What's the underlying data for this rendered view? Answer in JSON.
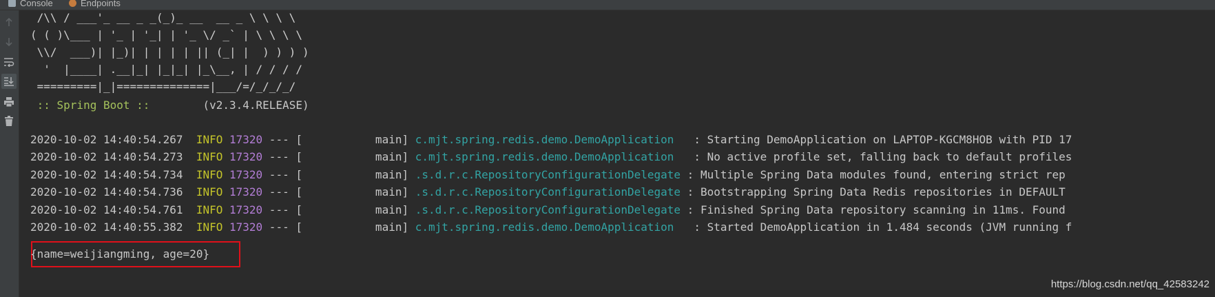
{
  "tabs": [
    {
      "label": "Console",
      "icon": "console-icon"
    },
    {
      "label": "Endpoints",
      "icon": "endpoints-icon"
    }
  ],
  "toolbar": {
    "buttons": [
      {
        "icon": "arrow-up-icon"
      },
      {
        "icon": "arrow-down-icon"
      },
      {
        "icon": "soft-wrap-icon"
      },
      {
        "icon": "scroll-to-end-icon",
        "active": true
      },
      {
        "icon": "print-icon"
      },
      {
        "icon": "clear-all-icon"
      }
    ]
  },
  "banner": {
    "lines": [
      " /\\\\ / ___'_ __ _ _(_)_ __  __ _ \\ \\ \\ \\",
      "( ( )\\___ | '_ | '_| | '_ \\/ _` | \\ \\ \\ \\",
      " \\\\/  ___)| |_)| | | | | || (_| |  ) ) ) )",
      "  '  |____| .__|_| |_|_| |_\\__, | / / / /",
      " =========|_|==============|___/=/_/_/_/"
    ],
    "boot_label": " :: Spring Boot :: ",
    "boot_version": "       (v2.3.4.RELEASE)"
  },
  "logs": [
    {
      "timestamp": "2020-10-02 14:40:54.267",
      "level": "INFO",
      "pid": "17320",
      "sep": " --- [",
      "thread": "           main]",
      "logger": "c.mjt.spring.redis.demo.DemoApplication  ",
      "message": ": Starting DemoApplication on LAPTOP-KGCM8HOB with PID 17"
    },
    {
      "timestamp": "2020-10-02 14:40:54.273",
      "level": "INFO",
      "pid": "17320",
      "sep": " --- [",
      "thread": "           main]",
      "logger": "c.mjt.spring.redis.demo.DemoApplication  ",
      "message": ": No active profile set, falling back to default profiles"
    },
    {
      "timestamp": "2020-10-02 14:40:54.734",
      "level": "INFO",
      "pid": "17320",
      "sep": " --- [",
      "thread": "           main]",
      "logger": ".s.d.r.c.RepositoryConfigurationDelegate",
      "message": " : Multiple Spring Data modules found, entering strict rep"
    },
    {
      "timestamp": "2020-10-02 14:40:54.736",
      "level": "INFO",
      "pid": "17320",
      "sep": " --- [",
      "thread": "           main]",
      "logger": ".s.d.r.c.RepositoryConfigurationDelegate",
      "message": " : Bootstrapping Spring Data Redis repositories in DEFAULT"
    },
    {
      "timestamp": "2020-10-02 14:40:54.761",
      "level": "INFO",
      "pid": "17320",
      "sep": " --- [",
      "thread": "           main]",
      "logger": ".s.d.r.c.RepositoryConfigurationDelegate",
      "message": " : Finished Spring Data repository scanning in 11ms. Found"
    },
    {
      "timestamp": "2020-10-02 14:40:55.382",
      "level": "INFO",
      "pid": "17320",
      "sep": " --- [",
      "thread": "           main]",
      "logger": "c.mjt.spring.redis.demo.DemoApplication  ",
      "message": ": Started DemoApplication in 1.484 seconds (JVM running f"
    }
  ],
  "output": "{name=weijiangming, age=20}",
  "watermark": "https://blog.csdn.net/qq_42583242",
  "colors": {
    "background": "#2b2b2b",
    "info_level": "#c5c52a",
    "pid": "#b37ed6",
    "logger": "#32a4a4",
    "boot_label": "#a5c25c",
    "highlight_border": "#e0101a"
  }
}
